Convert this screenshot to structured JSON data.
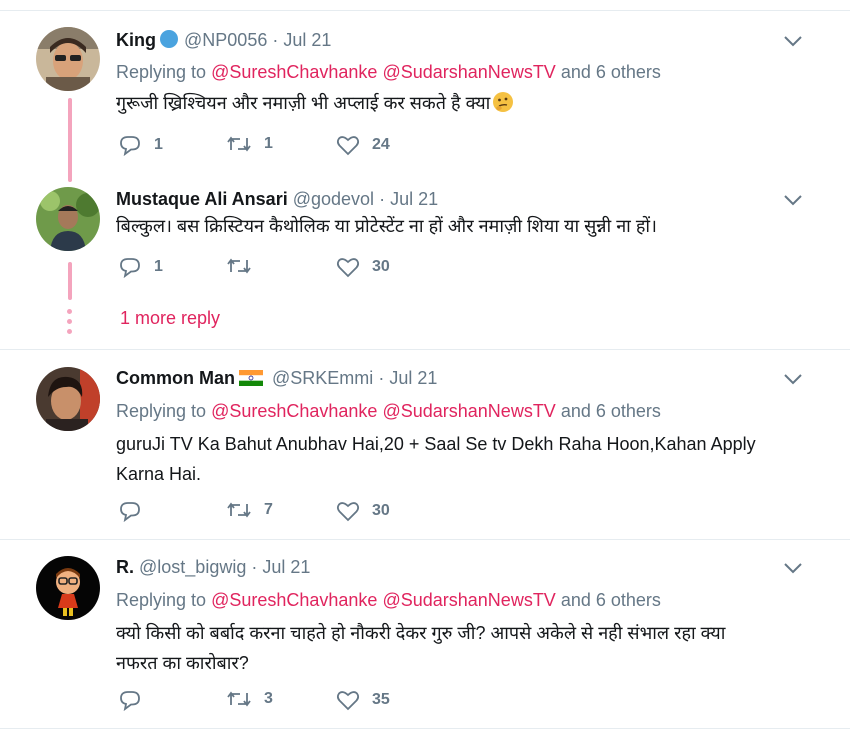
{
  "tweets": [
    {
      "name": "King",
      "handle": "@NP0056",
      "dot": "·",
      "date": "Jul 21",
      "replying_prefix": "Replying to",
      "mentions": [
        "@SureshChavhanke",
        "@SudarshanNewsTV"
      ],
      "replying_suffix": "and 6 others",
      "text": "गुरूजी ख्रिश्चियन और नमाज़ी भी अप्लाई कर सकते है क्या",
      "emoji": "thinking-face",
      "replies": "1",
      "retweets": "1",
      "likes": "24"
    },
    {
      "name": "Mustaque Ali Ansari",
      "handle": "@godevol",
      "dot": "·",
      "date": "Jul 21",
      "text": "बिल्कुल। बस क्रिस्टियन कैथोलिक या प्रोटेस्टेंट ना हों और नमाज़ी शिया या सुन्नी ना हों।",
      "replies": "1",
      "retweets": "",
      "likes": "30"
    },
    {
      "name": "Common Man",
      "handle": "@SRKEmmi",
      "dot": "·",
      "date": "Jul 21",
      "replying_prefix": "Replying to",
      "mentions": [
        "@SureshChavhanke",
        "@SudarshanNewsTV"
      ],
      "replying_suffix": "and 6 others",
      "text_line1": "guruJi TV Ka Bahut Anubhav Hai,20 + Saal Se tv Dekh Raha Hoon,Kahan Apply",
      "text_line2": "Karna Hai.",
      "replies": "",
      "retweets": "7",
      "likes": "30"
    },
    {
      "name": "R.",
      "handle": "@lost_bigwig",
      "dot": "·",
      "date": "Jul 21",
      "replying_prefix": "Replying to",
      "mentions": [
        "@SureshChavhanke",
        "@SudarshanNewsTV"
      ],
      "replying_suffix": "and 6 others",
      "text_line1": "क्यो किसी को बर्बाद करना चाहते हो नौकरी देकर गुरु जी? आपसे अकेले से नही संभाल रहा क्या",
      "text_line2": "नफरत का कारोबार?",
      "replies": "",
      "retweets": "3",
      "likes": "35"
    }
  ],
  "more_reply": "1 more reply",
  "colors": {
    "mention": "#e0245e",
    "muted": "#657786",
    "thread": "#f4a4bd"
  }
}
